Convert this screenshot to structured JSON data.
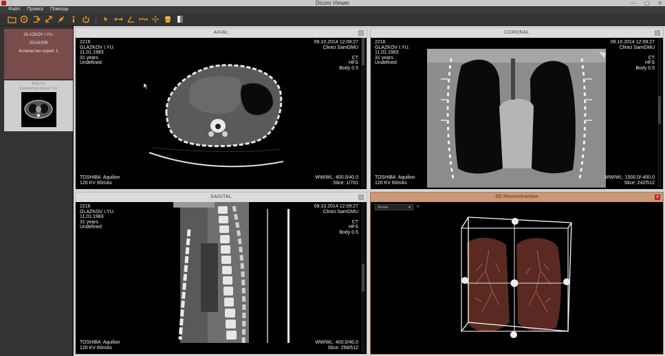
{
  "window": {
    "title": "Dicom Viewer",
    "controls": [
      "—",
      "▢",
      "✕"
    ]
  },
  "menu": [
    "Файл",
    "Правка",
    "Помощь"
  ],
  "toolbar": {
    "icons": [
      "folder-icon",
      "disk-icon",
      "export-icon",
      "expand-icon",
      "collapse-icon",
      "info-icon",
      "power-icon",
      "pointer-icon",
      "measure-line-icon",
      "angle-icon",
      "ruler-icon",
      "crosshair-icon",
      "bucket-icon",
      "window-level-icon"
    ]
  },
  "study": {
    "patient_name": "GLAZKOV I.YU.",
    "study_date": "20141009",
    "series_count": "Количество серий: 1"
  },
  "series": {
    "name": "Body 0.5",
    "count_text": "Количество срезов: 701"
  },
  "panels": {
    "axial": {
      "title": "AXIAL",
      "tl": "2216\nGLAZKOV I.YU.\n11.01.1983\n31 years\nUndefined",
      "tr": "09.10.2014 12:09:27\nClinici SamGMU\n\nCT\nHFS\nBody 0.5",
      "bl": "TOSHIBA  Aquilion\n120 KV 60mAs",
      "br": "WW/WL: 400.0/40.0\nSlice: 1/701"
    },
    "coronal": {
      "title": "CORONAL",
      "tl": "2216\nGLAZKOV I.YU.\n11.01.1983\n31 years\nUndefined",
      "tr": "09.10.2014 12:09:27\nClinici SamGMU\n\nCT\nHFS\nBody 0.5",
      "bl": "TOSHIBA  Aquilion\n120 KV 60mAs",
      "br": "WW/WL: 1500.0/-400.0\nSlice: 242/512"
    },
    "sagital": {
      "title": "SAGITAL",
      "tl": "2216\nGLAZKOV I.YU.\n11.01.1983\n31 years\nUndefined",
      "tr": "09.10.2014 12:09:27\nClinici SamGMU\n\nCT\nHFS\nBody 0.5",
      "bl": "TOSHIBA  Aquilion\n120 KV 60mAs",
      "br": "WW/WL: 400.0/40.0\nSlice: 256/512"
    },
    "recon3d": {
      "title": "3D Reconstruction",
      "preset": "Легкие"
    }
  },
  "colors": {
    "patient_card": "#7a4b4b",
    "toolbar_icon": "#f0a020",
    "recon_header": "#c99878",
    "close_red": "#d23a2a"
  }
}
